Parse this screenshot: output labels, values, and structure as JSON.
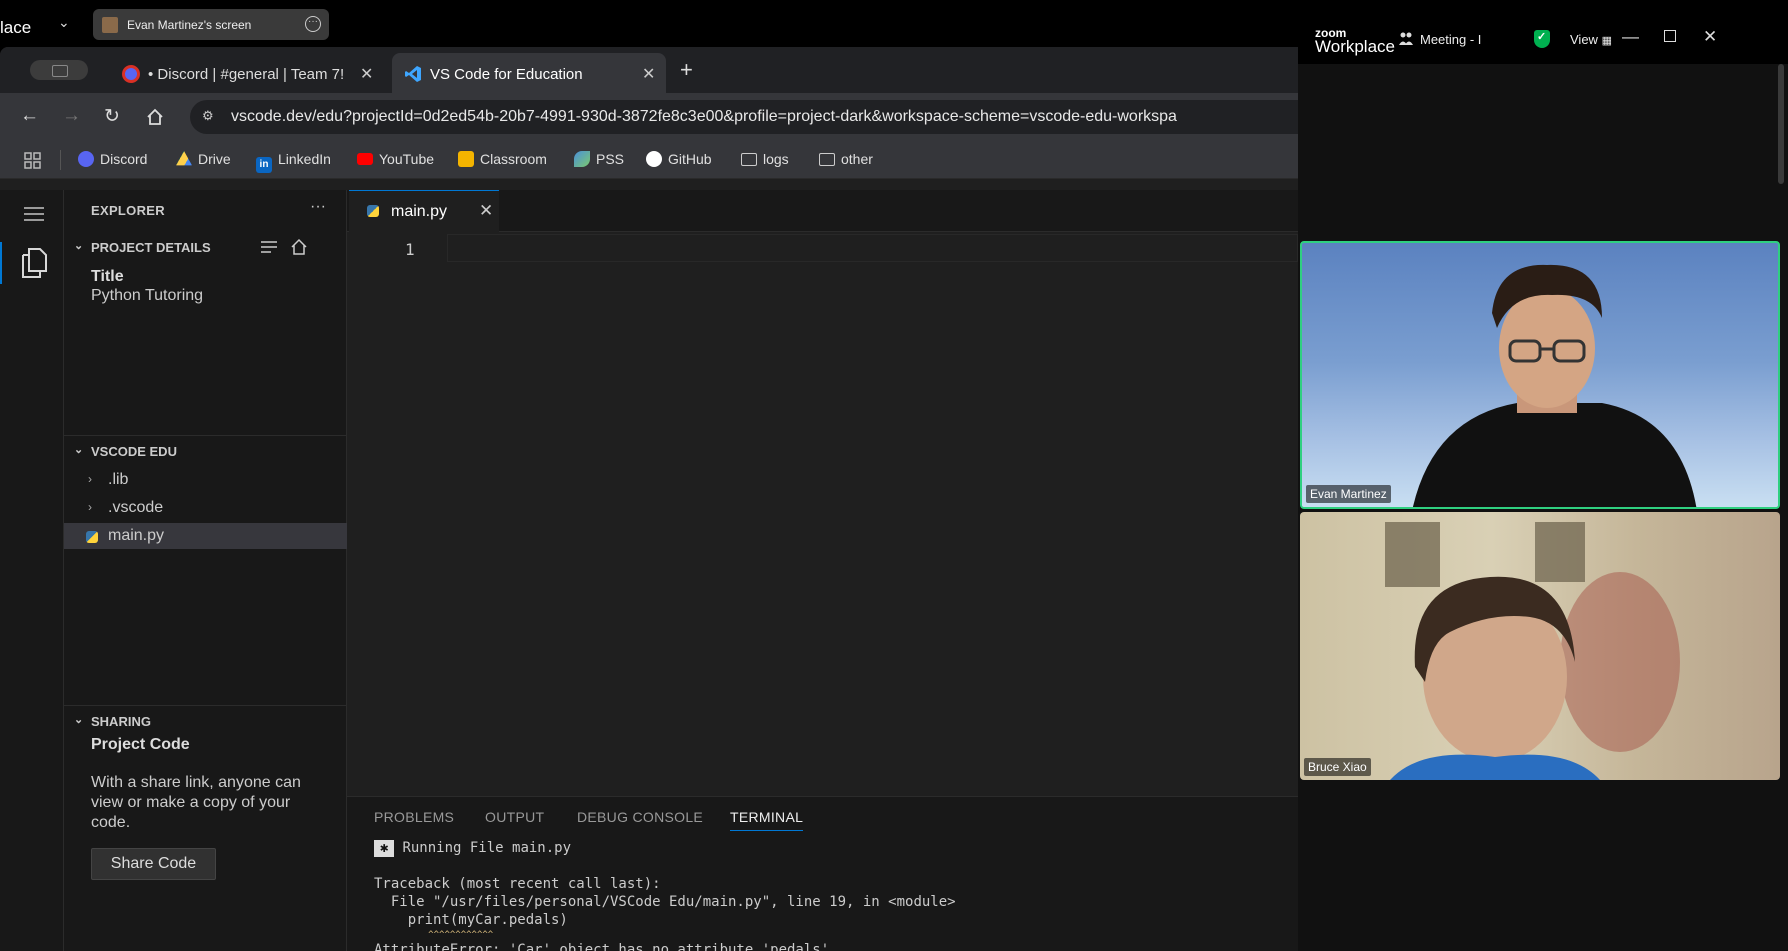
{
  "share_bar": {
    "app_name": "lace",
    "presenter_label": "Evan Martinez's screen"
  },
  "browser": {
    "tabs": [
      {
        "title": "• Discord | #general | Team 7!"
      },
      {
        "title": "VS Code for Education"
      }
    ],
    "url": "vscode.dev/edu?projectId=0d2ed54b-20b7-4991-930d-3872fe8c3e00&profile=project-dark&workspace-scheme=vscode-edu-workspa",
    "bookmarks": [
      {
        "label": "Discord",
        "color": "#5865f2"
      },
      {
        "label": "Drive",
        "color": "#1fa463"
      },
      {
        "label": "LinkedIn",
        "color": "#0a66c2"
      },
      {
        "label": "YouTube",
        "color": "#ff0000"
      },
      {
        "label": "Classroom",
        "color": "#f4b400"
      },
      {
        "label": "PSS",
        "color": "#4a90d9"
      },
      {
        "label": "GitHub",
        "color": "#ffffff"
      },
      {
        "label": "logs",
        "color": "#cccccc"
      },
      {
        "label": "other",
        "color": "#cccccc"
      }
    ]
  },
  "sidebar": {
    "explorer_title": "EXPLORER",
    "more": "···",
    "project_details": {
      "header": "PROJECT DETAILS",
      "title_label": "Title",
      "title_value": "Python Tutoring"
    },
    "vscode_edu": {
      "header": "VSCODE EDU",
      "items": [
        ".lib",
        ".vscode",
        "main.py"
      ]
    },
    "sharing": {
      "header": "SHARING",
      "title": "Project Code",
      "desc_lines": [
        "With a share link, anyone can",
        "view or make a copy of your",
        "code."
      ],
      "button": "Share Code"
    }
  },
  "editor": {
    "tab_name": "main.py",
    "line_number": "1"
  },
  "panel": {
    "tabs": [
      "PROBLEMS",
      "OUTPUT",
      "DEBUG CONSOLE",
      "TERMINAL"
    ],
    "active_tab": "TERMINAL",
    "terminal": {
      "badge": "✱",
      "running": "Running File main.py",
      "lines": [
        "Traceback (most recent call last):",
        "  File \"/usr/files/personal/VSCode Edu/main.py\", line 19, in <module>",
        "    print(myCar.pedals)",
        "          ^^^^^^^^^^^^",
        "AttributeError: 'Car' object has no attribute 'pedals'"
      ]
    }
  },
  "zoom": {
    "logo_small": "zoom",
    "logo_big": "Workplace",
    "meeting_label": "Meeting - I",
    "view_label": "View",
    "participants": [
      {
        "name": "Evan Martinez"
      },
      {
        "name": "Bruce Xiao"
      }
    ]
  }
}
